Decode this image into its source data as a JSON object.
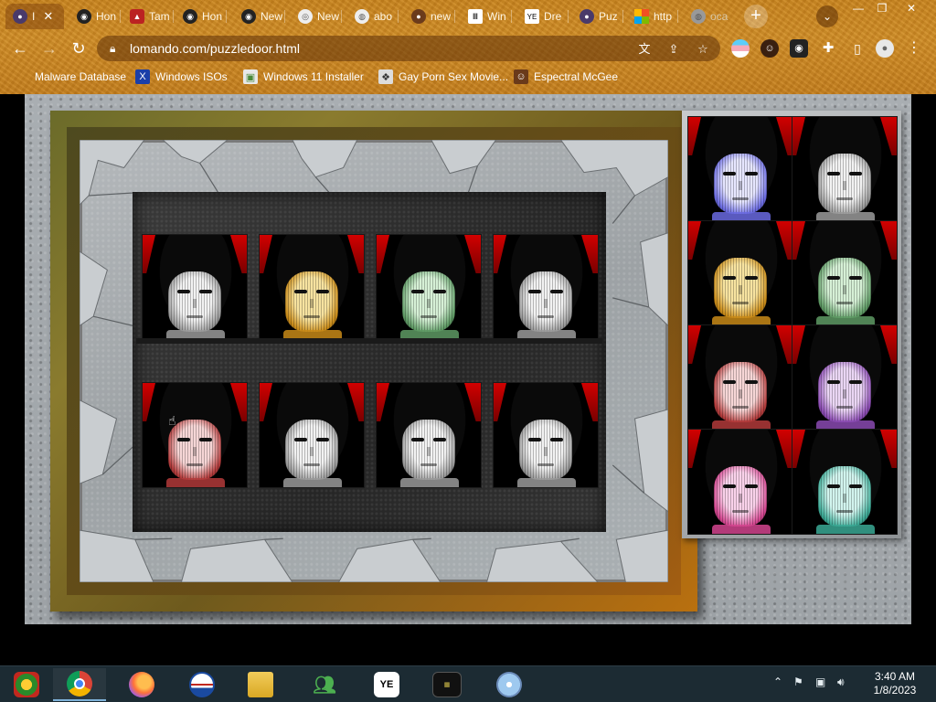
{
  "browser": {
    "tabs": [
      {
        "label": "I",
        "icon": "owl-avatar-icon",
        "active": true
      },
      {
        "label": "Hon",
        "icon": "sunglasses-avatar-icon"
      },
      {
        "label": "Tam",
        "icon": "tamriel-icon"
      },
      {
        "label": "Hon",
        "icon": "sunglasses-avatar-icon"
      },
      {
        "label": "New",
        "icon": "sunglasses-avatar-icon"
      },
      {
        "label": "New",
        "icon": "chrome-icon"
      },
      {
        "label": "abo",
        "icon": "globe-icon"
      },
      {
        "label": "new",
        "icon": "cookie-icon"
      },
      {
        "label": "Win",
        "icon": "archive-icon"
      },
      {
        "label": "Dre",
        "icon": "ye-icon"
      },
      {
        "label": "Puz",
        "icon": "owl-avatar-icon"
      },
      {
        "label": "http",
        "icon": "microsoft-icon"
      },
      {
        "label": "oca",
        "icon": "globe-icon"
      }
    ],
    "tab_close_symbol": "✕",
    "new_tab_symbol": "+",
    "url": "lomando.com/puzzledoor.html",
    "bookmarks": [
      {
        "label": "Malware Database",
        "icon": "folder-icon"
      },
      {
        "label": "Windows ISOs",
        "icon": "x-icon"
      },
      {
        "label": "Windows 11 Installer",
        "icon": "image-icon"
      },
      {
        "label": "Gay Porn Sex Movie...",
        "icon": "page-icon"
      },
      {
        "label": "Espectral McGee",
        "icon": "character-icon"
      }
    ],
    "accent": "#c9841d"
  },
  "puzzle": {
    "board_tiles": [
      {
        "tint": "white"
      },
      {
        "tint": "gold"
      },
      {
        "tint": "green"
      },
      {
        "tint": "white"
      },
      {
        "tint": "red"
      },
      {
        "tint": "white"
      },
      {
        "tint": "white"
      },
      {
        "tint": "white"
      }
    ],
    "piece_tiles": [
      {
        "tint": "blue"
      },
      {
        "tint": "white"
      },
      {
        "tint": "gold"
      },
      {
        "tint": "green"
      },
      {
        "tint": "red"
      },
      {
        "tint": "purple"
      },
      {
        "tint": "pink"
      },
      {
        "tint": "teal"
      }
    ],
    "frame_color": "#8a6a1e",
    "wall_color": "#a3a8ac"
  },
  "taskbar": {
    "apps": [
      {
        "name": "explorer-ish",
        "icon": "media-center-icon"
      },
      {
        "name": "chrome",
        "icon": "chrome-icon",
        "active": true
      },
      {
        "name": "firefox",
        "icon": "firefox-icon"
      },
      {
        "name": "obama",
        "icon": "obama-logo-icon"
      },
      {
        "name": "files",
        "icon": "file-explorer-icon"
      },
      {
        "name": "messenger",
        "icon": "messenger-icon"
      },
      {
        "name": "ye",
        "icon": "ye-icon"
      },
      {
        "name": "warning",
        "icon": "terminal-warning-icon"
      },
      {
        "name": "disc",
        "icon": "disc-setup-icon"
      }
    ],
    "time": "3:40 AM",
    "date": "1/8/2023"
  }
}
